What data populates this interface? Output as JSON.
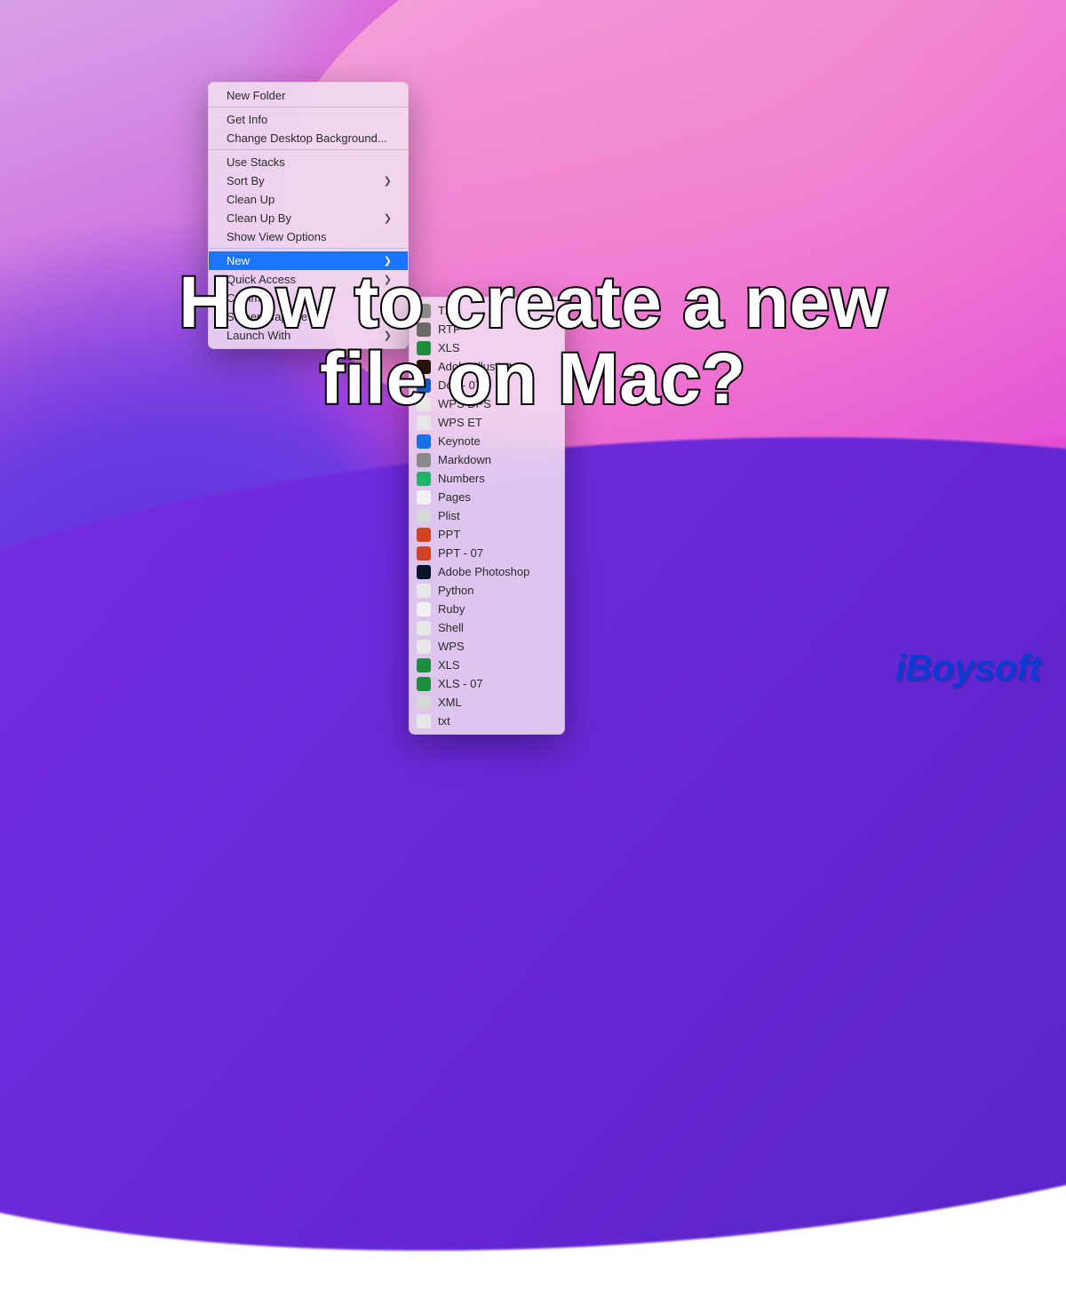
{
  "headline_line1": "How to create a new",
  "headline_line2": "file on Mac?",
  "logo_text": "iBoysoft",
  "primary_menu": {
    "groups": [
      {
        "items": [
          {
            "label": "New Folder"
          }
        ]
      },
      {
        "items": [
          {
            "label": "Get Info"
          },
          {
            "label": "Change Desktop Background..."
          }
        ]
      },
      {
        "items": [
          {
            "label": "Use Stacks"
          },
          {
            "label": "Sort By",
            "submenu": true
          },
          {
            "label": "Clean Up"
          },
          {
            "label": "Clean Up By",
            "submenu": true
          },
          {
            "label": "Show View Options"
          }
        ]
      },
      {
        "items": [
          {
            "label": "New",
            "submenu": true,
            "selected": true
          },
          {
            "label": "Quick Access",
            "submenu": true
          },
          {
            "label": "Common",
            "submenu": true
          },
          {
            "label": "Screen Capture",
            "submenu": true
          },
          {
            "label": "Launch With",
            "submenu": true
          }
        ]
      }
    ]
  },
  "secondary_menu": {
    "items": [
      {
        "label": "TXT",
        "icon_color": "#8a8a8a"
      },
      {
        "label": "RTF",
        "icon_color": "#6a6a6a"
      },
      {
        "label": "XLS",
        "icon_color": "#1e8e3e"
      },
      {
        "label": "Adobe Illustrator",
        "icon_color": "#2a1409"
      },
      {
        "label": "Doc - 07",
        "icon_color": "#1658c6"
      },
      {
        "label": "WPS DPS",
        "icon_color": "#e7e7e7"
      },
      {
        "label": "WPS ET",
        "icon_color": "#e7e7e7"
      },
      {
        "label": "Keynote",
        "icon_color": "#1a6fe6"
      },
      {
        "label": "Markdown",
        "icon_color": "#8a8a8a"
      },
      {
        "label": "Numbers",
        "icon_color": "#20b36a"
      },
      {
        "label": "Pages",
        "icon_color": "#f0f0f0"
      },
      {
        "label": "Plist",
        "icon_color": "#d7d7d7"
      },
      {
        "label": "PPT",
        "icon_color": "#d04423"
      },
      {
        "label": "PPT - 07",
        "icon_color": "#d04423"
      },
      {
        "label": "Adobe Photoshop",
        "icon_color": "#07142a"
      },
      {
        "label": "Python",
        "icon_color": "#e8e8e8"
      },
      {
        "label": "Ruby",
        "icon_color": "#f1f1f1"
      },
      {
        "label": "Shell",
        "icon_color": "#e8e8e8"
      },
      {
        "label": "WPS",
        "icon_color": "#e7e7e7"
      },
      {
        "label": "XLS",
        "icon_color": "#1e8e3e"
      },
      {
        "label": "XLS - 07",
        "icon_color": "#1e8e3e"
      },
      {
        "label": "XML",
        "icon_color": "#d7d7d7"
      },
      {
        "label": "txt",
        "icon_color": "#e7e7e7"
      }
    ]
  }
}
